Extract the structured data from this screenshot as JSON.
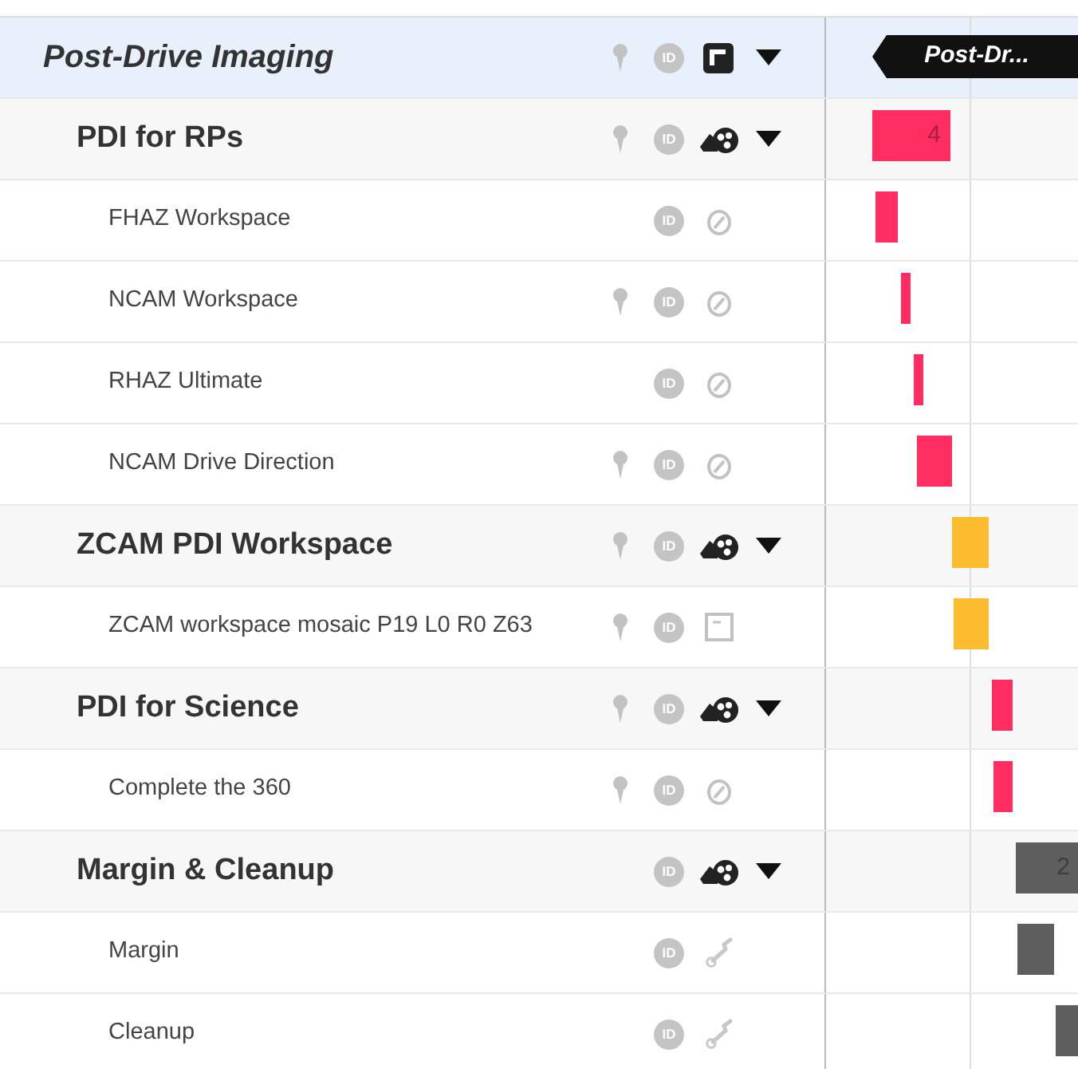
{
  "rows": [
    {
      "kind": "phase",
      "title": "Post-Drive Imaging",
      "pinned": true,
      "id_label": "ID",
      "type_icon": {
        "kind": "layers"
      },
      "expanded": true,
      "tag": "Post-Dr..."
    },
    {
      "kind": "group",
      "title": "PDI for RPs",
      "pinned": true,
      "id_label": "ID",
      "type_icon": {
        "kind": "cluster"
      },
      "expanded": true,
      "bar": {
        "color": "#ff2d62",
        "label": "4"
      }
    },
    {
      "kind": "task",
      "title": "FHAZ Workspace",
      "pinned": false,
      "id_label": "ID",
      "type_icon": {
        "kind": "gauge"
      },
      "bar": {
        "color": "#ff2d62"
      }
    },
    {
      "kind": "task",
      "title": "NCAM Workspace",
      "pinned": true,
      "id_label": "ID",
      "type_icon": {
        "kind": "gauge"
      },
      "bar": {
        "color": "#ff2d62"
      }
    },
    {
      "kind": "task",
      "title": "RHAZ Ultimate",
      "pinned": false,
      "id_label": "ID",
      "type_icon": {
        "kind": "gauge"
      },
      "bar": {
        "color": "#ff2d62"
      }
    },
    {
      "kind": "task",
      "title": "NCAM Drive Direction",
      "pinned": true,
      "id_label": "ID",
      "type_icon": {
        "kind": "gauge"
      },
      "bar": {
        "color": "#ff2d62"
      }
    },
    {
      "kind": "group",
      "title": "ZCAM PDI Workspace",
      "pinned": true,
      "id_label": "ID",
      "type_icon": {
        "kind": "cluster"
      },
      "expanded": true,
      "bar": {
        "color": "#fbbc2f"
      }
    },
    {
      "kind": "task",
      "title": "ZCAM workspace mosaic P19 L0 R0 Z63",
      "pinned": true,
      "id_label": "ID",
      "type_icon": {
        "kind": "note"
      },
      "bar": {
        "color": "#fbbc2f"
      }
    },
    {
      "kind": "group",
      "title": "PDI for Science",
      "pinned": true,
      "id_label": "ID",
      "type_icon": {
        "kind": "cluster"
      },
      "expanded": true,
      "bar": {
        "color": "#ff2d62"
      }
    },
    {
      "kind": "task",
      "title": "Complete the 360",
      "pinned": true,
      "id_label": "ID",
      "type_icon": {
        "kind": "gauge"
      },
      "bar": {
        "color": "#ff2d62"
      }
    },
    {
      "kind": "group",
      "title": "Margin & Cleanup",
      "pinned": false,
      "id_label": "ID",
      "type_icon": {
        "kind": "cluster"
      },
      "expanded": true,
      "bar": {
        "color": "#5e5e5e",
        "label": "2"
      }
    },
    {
      "kind": "task",
      "title": "Margin",
      "pinned": false,
      "id_label": "ID",
      "type_icon": {
        "kind": "wrench"
      },
      "bar": {
        "color": "#5e5e5e"
      }
    },
    {
      "kind": "task",
      "title": "Cleanup",
      "pinned": false,
      "id_label": "ID",
      "type_icon": {
        "kind": "wrench"
      },
      "bar": {
        "color": "#5e5e5e"
      }
    }
  ]
}
